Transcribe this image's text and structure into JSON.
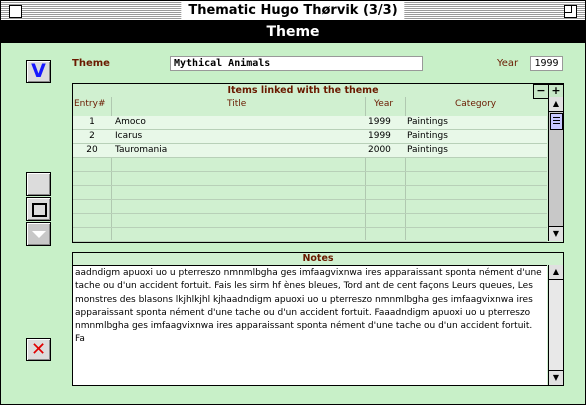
{
  "window": {
    "title": "Thematic Hugo Thørvik (3/3)"
  },
  "header": {
    "title": "Theme"
  },
  "form": {
    "theme_label": "Theme",
    "theme_value": "Mythical Animals",
    "year_label": "Year",
    "year_value": "1999"
  },
  "items": {
    "title": "Items linked with the theme",
    "minus": "−",
    "plus": "+",
    "columns": {
      "entry": "Entry#",
      "title": "Title",
      "year": "Year",
      "category": "Category"
    },
    "rows": [
      {
        "entry": "1",
        "title": "Amoco",
        "year": "1999",
        "category": "Paintings"
      },
      {
        "entry": "2",
        "title": "Icarus",
        "year": "1999",
        "category": "Paintings"
      },
      {
        "entry": "20",
        "title": "Tauromania",
        "year": "2000",
        "category": "Paintings"
      }
    ]
  },
  "notes": {
    "title": "Notes",
    "text": "aadndigm apuoxi uo u pterreszo nmnmlbgha ges imfaagvixnwa ires apparaissant sponta nément d'une tache ou d'un accident fortuit. Fais les sirm hf ènes bleues, Tord  ant de cent façons Leurs queues, Les monstres des blasons lkjhlkjhl kjhaadndigm apuoxi uo u pterreszo nmnmlbgha ges imfaagvixnwa ires apparaissant sponta nément d'une tache ou d'un accident fortuit. Faaadndigm apuoxi uo u pterreszo nmnmlbgha ges imfaagvixnwa ires apparaissant sponta nément d'une tache ou d'un accident fortuit. Fa"
  },
  "buttons": {
    "validate": "V",
    "delete": "✕"
  },
  "colors": {
    "background": "#c8f0c8",
    "label": "#6a1a00",
    "validate": "#1818ff",
    "delete": "#e00000"
  }
}
